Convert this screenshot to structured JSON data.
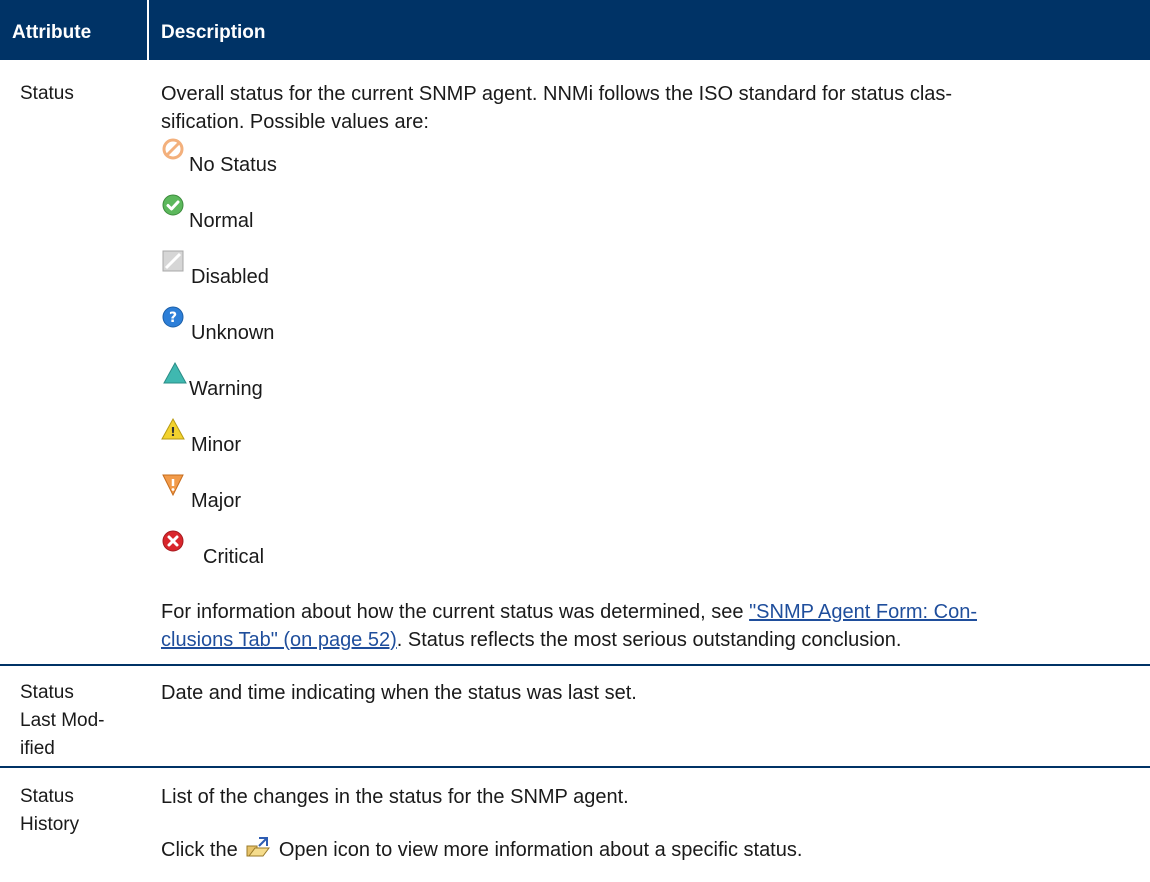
{
  "header": {
    "attribute": "Attribute",
    "description": "Description"
  },
  "rows": {
    "status": {
      "attribute": "Status",
      "intro_line1": "Overall status for the current SNMP agent. NNMi follows the ISO standard for status clas-",
      "intro_line2": "sification. Possible values are:",
      "values": [
        {
          "icon": "no-status-icon",
          "label": "No Status"
        },
        {
          "icon": "normal-icon",
          "label": "Normal"
        },
        {
          "icon": "disabled-icon",
          "label": "Disabled"
        },
        {
          "icon": "unknown-icon",
          "label": "Unknown"
        },
        {
          "icon": "warning-icon",
          "label": "Warning"
        },
        {
          "icon": "minor-icon",
          "label": "Minor"
        },
        {
          "icon": "major-icon",
          "label": "Major"
        },
        {
          "icon": "critical-icon",
          "label": "Critical"
        }
      ],
      "info_prefix": "For information about how the current status was determined, see ",
      "info_link_line1": "\"SNMP Agent Form: Con-",
      "info_link_line2": "clusions Tab\" (on page 52)",
      "info_suffix": ". Status reflects the most serious outstanding conclusion."
    },
    "status_last_modified": {
      "attribute_line1": "Status",
      "attribute_line2": "Last Mod-",
      "attribute_line3": "ified",
      "description": "Date and time indicating when the status was last set."
    },
    "status_history": {
      "attribute_line1": "Status",
      "attribute_line2": "History",
      "description": "List of the changes in the status for the SNMP agent.",
      "click_prefix": "Click the",
      "click_suffix": "Open icon to view more information about a specific status."
    }
  },
  "colors": {
    "header_bg": "#003366",
    "link": "#1f4e9c",
    "rule": "#003366"
  }
}
